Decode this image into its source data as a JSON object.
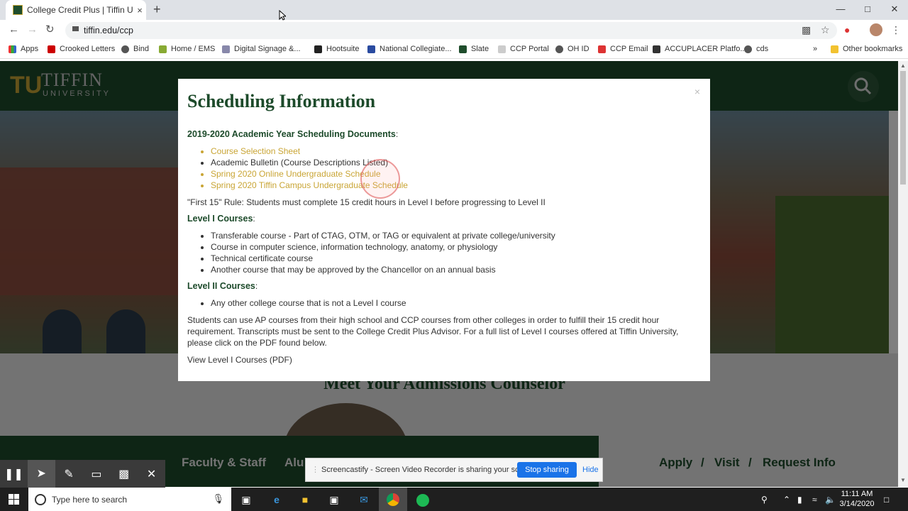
{
  "browser": {
    "tab_title": "College Credit Plus | Tiffin Univer",
    "tab_close": "×",
    "new_tab": "+",
    "url": "tiffin.edu/ccp",
    "bookmarks": [
      "Apps",
      "Crooked Letters",
      "Bind",
      "Home / EMS",
      "Digital Signage &...",
      "Hootsuite",
      "National Collegiate...",
      "Slate",
      "CCP Portal",
      "OH ID",
      "CCP Email",
      "ACCUPLACER Platfo...",
      "cds"
    ],
    "overflow": "»",
    "other_bookmarks": "Other bookmarks"
  },
  "site": {
    "logo_mark": "TU",
    "logo_name": "TIFFIN",
    "logo_sub": "UNIVERSITY",
    "meet_heading": "Meet Your Admissions Counselor",
    "footer_links": [
      "Faculty & Staff",
      "Alu"
    ],
    "quick_links": [
      "Apply",
      "/",
      "Visit",
      "/",
      "Request Info"
    ]
  },
  "modal": {
    "title": "Scheduling Information",
    "close": "×",
    "section1_heading": "2019-2020 Academic Year Scheduling Documents",
    "section1_items": [
      "Course Selection Sheet",
      "Academic Bulletin (Course Descriptions Listed)",
      "Spring 2020 Online Undergraduate Schedule",
      "Spring 2020 Tiffin Campus Undergraduate Schedule"
    ],
    "rule_text": "\"First 15\" Rule: Students must complete 15 credit hours in Level I before progressing to Level II",
    "level1_heading": "Level I Courses",
    "level1_items": [
      "Transferable course - Part of CTAG, OTM, or TAG or equivalent at private college/university",
      "Course in computer science, information technology, anatomy, or physiology",
      "Technical certificate course",
      "Another course that may be approved by the Chancellor on an annual basis"
    ],
    "level2_heading": "Level II Courses",
    "level2_items": [
      "Any other college course that is not a Level I course"
    ],
    "paragraph": "Students can use AP courses from their high school and CCP courses from other colleges in order to fulfill their 15 credit hour requirement. Transcripts must be sent to the College Credit Plus Advisor. For a full list of Level I courses offered at Tiffin University, please click on the PDF found below.",
    "pdf_link": "View Level I Courses (PDF)"
  },
  "screencastify": {
    "message": "Screencastify - Screen Video Recorder is sharing your screen.",
    "stop_label": "Stop sharing",
    "hide_label": "Hide"
  },
  "taskbar": {
    "search_placeholder": "Type here to search",
    "time": "11:11 AM",
    "date": "3/14/2020"
  },
  "colors": {
    "brand_green": "#1c4a2a",
    "brand_gold": "#c9a535",
    "link_blue": "#1a73e8"
  }
}
